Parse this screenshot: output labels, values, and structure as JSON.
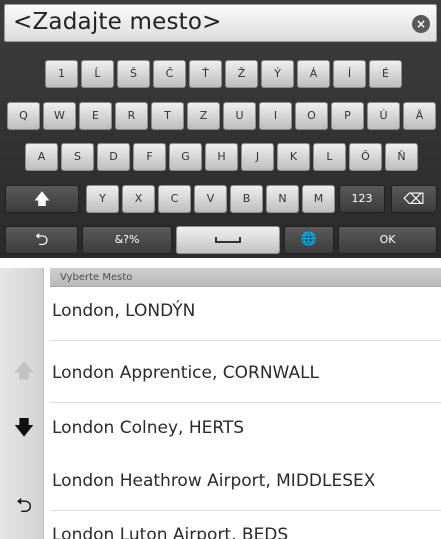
{
  "search": {
    "text": "<Zadajte mesto>",
    "clear_glyph": "×"
  },
  "keyboard": {
    "row1": [
      "1",
      "Ĺ",
      "Š",
      "Č",
      "Ť",
      "Ž",
      "Ý",
      "Á",
      "Í",
      "É"
    ],
    "row2": [
      "Q",
      "W",
      "E",
      "R",
      "T",
      "Z",
      "U",
      "I",
      "O",
      "P",
      "Ú",
      "Ä"
    ],
    "row3": [
      "A",
      "S",
      "D",
      "F",
      "G",
      "H",
      "J",
      "K",
      "L",
      "Ô",
      "Ň"
    ],
    "row4": [
      "Y",
      "X",
      "C",
      "V",
      "B",
      "N",
      "M"
    ],
    "shift_glyph": "🡅",
    "numeric_label": "123",
    "backspace_glyph": "⌫",
    "back_glyph": "⮌",
    "symbols_label": "&?%",
    "globe_glyph": "🌐",
    "ok_label": "OK"
  },
  "list": {
    "header": "Vyberte Mesto",
    "items": [
      "London, LONDÝN",
      "London Apprentice, CORNWALL",
      "London Colney, HERTS",
      "London Heathrow Airport, MIDDLESEX",
      "London Luton Airport, BEDS"
    ],
    "scroll_up_glyph": "🡅",
    "scroll_down_glyph": "🡇",
    "back_glyph": "⮌"
  },
  "colors": {
    "keyboard_bg": "#333333",
    "key_light": "#dcdcdc",
    "key_dark": "#4a4a4a",
    "list_header": "#c4c4c4"
  }
}
